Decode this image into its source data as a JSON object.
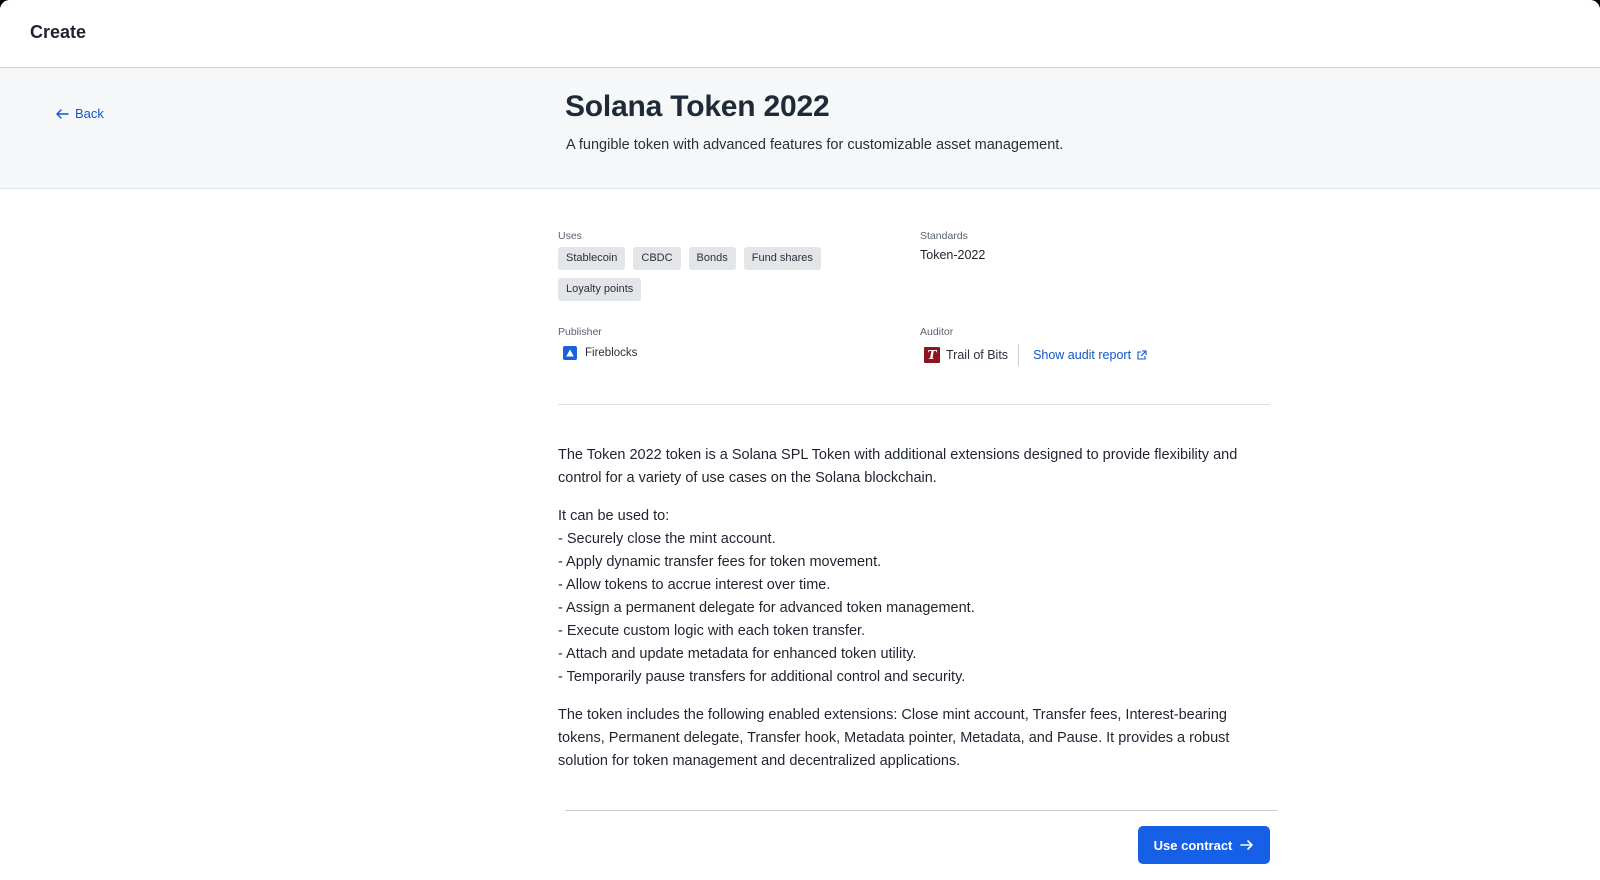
{
  "topbar": {
    "title": "Create"
  },
  "hero": {
    "back_label": "Back",
    "title": "Solana Token 2022",
    "subtitle": "A fungible token with advanced features for customizable asset management."
  },
  "meta": {
    "uses_label": "Uses",
    "uses": [
      "Stablecoin",
      "CBDC",
      "Bonds",
      "Fund shares",
      "Loyalty points"
    ],
    "standards_label": "Standards",
    "standards_value": "Token-2022",
    "publisher_label": "Publisher",
    "publisher_name": "Fireblocks",
    "auditor_label": "Auditor",
    "auditor_name": "Trail of Bits",
    "audit_link": "Show audit report"
  },
  "description": {
    "intro": "The Token 2022 token is a Solana SPL Token with additional extensions designed to provide flexibility and control for a variety of use cases on the Solana blockchain.",
    "uses_heading": "It can be used to:",
    "uses_list": [
      "- Securely close the mint account.",
      "- Apply dynamic transfer fees for token movement.",
      "- Allow tokens to accrue interest over time.",
      "- Assign a permanent delegate for advanced token management.",
      "- Execute custom logic with each token transfer.",
      "- Attach and update metadata for enhanced token utility.",
      "- Temporarily pause transfers for additional control and security."
    ],
    "extensions": "The token includes the following enabled extensions: Close mint account, Transfer fees, Interest-bearing tokens, Permanent delegate, Transfer hook, Metadata pointer, Metadata, and Pause. It provides a robust solution for token management and decentralized applications."
  },
  "actions": {
    "use_contract_label": "Use contract"
  },
  "colors": {
    "accent": "#1560e6",
    "link": "#1357c8",
    "hero_bg": "#f6f7f9",
    "chip_bg": "#e3e5e9",
    "fireblocks_blue": "#1a5fdc",
    "trail_of_bits_red": "#8b1620"
  }
}
